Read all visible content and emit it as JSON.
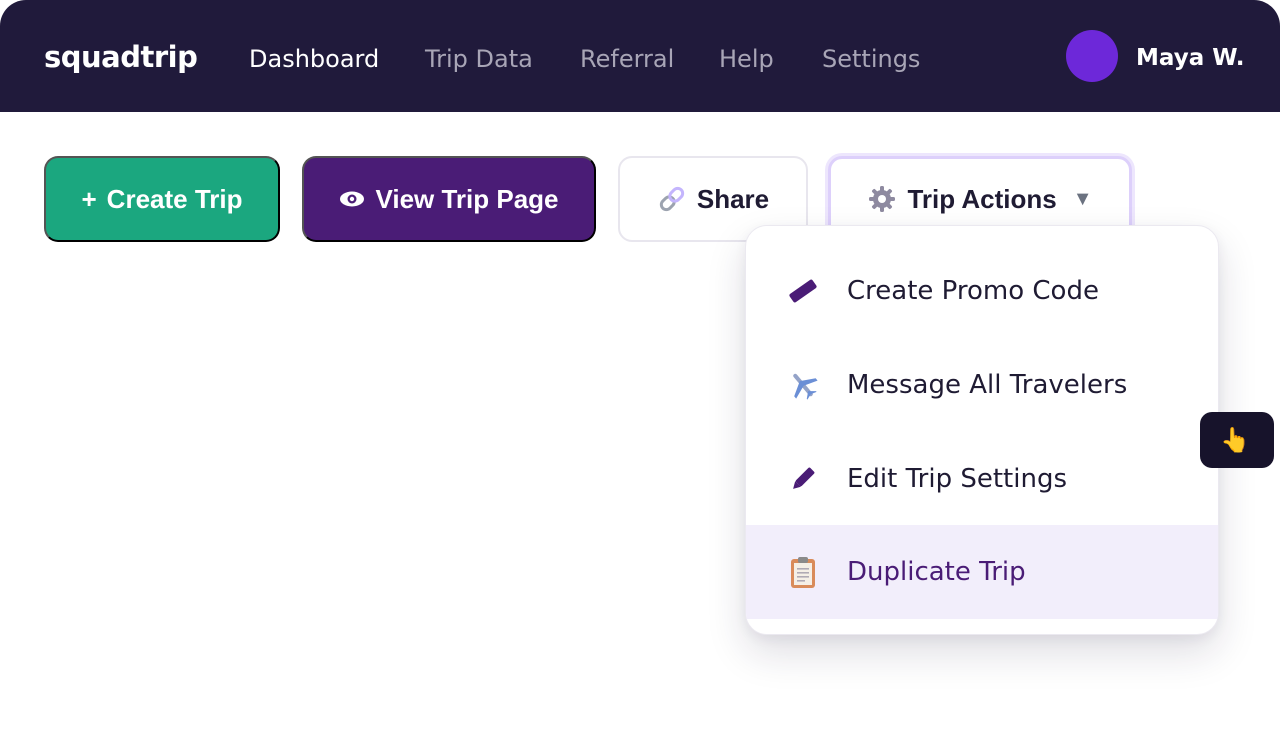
{
  "brand": {
    "name": "squadtrip"
  },
  "nav": {
    "items": [
      {
        "label": "Dashboard",
        "active": true
      },
      {
        "label": "Trip Data",
        "active": false
      },
      {
        "label": "Referral",
        "active": false
      },
      {
        "label": "Help",
        "active": false
      },
      {
        "label": "Settings",
        "active": false
      }
    ]
  },
  "user": {
    "name": "Maya W.",
    "avatar_color": "#6d28d9"
  },
  "actions": {
    "create_label": "Create Trip",
    "create_icon": "plus",
    "view_label": "View Trip Page",
    "view_icon": "eye-icon",
    "share_label": "Share",
    "share_icon": "link-icon",
    "trip_actions_label": "Trip Actions",
    "trip_actions_icon": "gear-icon",
    "trip_actions_caret": "chevron-down-icon"
  },
  "menu": {
    "items": [
      {
        "label": "Create Promo Code",
        "icon": "ticket-icon"
      },
      {
        "label": "Message All Travelers",
        "icon": "airplane-icon"
      },
      {
        "label": "Edit Trip Settings",
        "icon": "pencil-icon"
      },
      {
        "label": "Duplicate Trip",
        "icon": "clipboard-icon",
        "highlighted": true
      }
    ]
  },
  "tooltip": {
    "icon": "pointing-hand-icon"
  },
  "colors": {
    "nav_bg": "#201a3b",
    "create_bg": "#1ba77f",
    "view_bg": "#4a1c76",
    "highlight_bg": "#f2eefb",
    "highlight_text": "#4a1c76"
  }
}
